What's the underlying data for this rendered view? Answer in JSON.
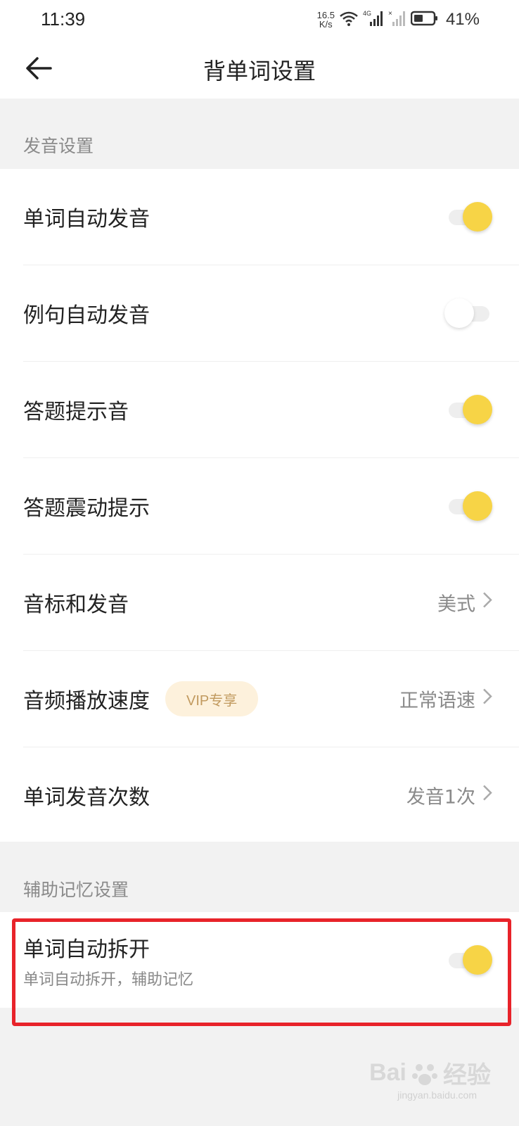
{
  "status_bar": {
    "time": "11:39",
    "net_speed_value": "16.5",
    "net_speed_unit": "K/s",
    "network_type": "4G",
    "battery_percent": "41%"
  },
  "header": {
    "title": "背单词设置",
    "back_icon": "arrow-left-icon"
  },
  "sections": {
    "pronunciation": {
      "label": "发音设置",
      "rows": [
        {
          "label": "单词自动发音",
          "type": "toggle",
          "on": true
        },
        {
          "label": "例句自动发音",
          "type": "toggle",
          "on": false
        },
        {
          "label": "答题提示音",
          "type": "toggle",
          "on": true
        },
        {
          "label": "答题震动提示",
          "type": "toggle",
          "on": true
        },
        {
          "label": "音标和发音",
          "type": "select",
          "value": "美式"
        },
        {
          "label": "音频播放速度",
          "type": "select",
          "badge": "VIP专享",
          "value": "正常语速"
        },
        {
          "label": "单词发音次数",
          "type": "select",
          "value": "发音1次"
        }
      ]
    },
    "memory": {
      "label": "辅助记忆设置",
      "rows": [
        {
          "label": "单词自动拆开",
          "description": "单词自动拆开，辅助记忆",
          "type": "toggle",
          "on": true
        }
      ]
    }
  },
  "colors": {
    "accent_toggle": "#f7d446",
    "highlight_border": "#e8232a",
    "vip_badge_bg": "#fdf1dc",
    "vip_badge_text": "#c19a5f"
  },
  "watermark": {
    "brand": "Bai",
    "brand_suffix": "经验",
    "url": "jingyan.baidu.com"
  }
}
